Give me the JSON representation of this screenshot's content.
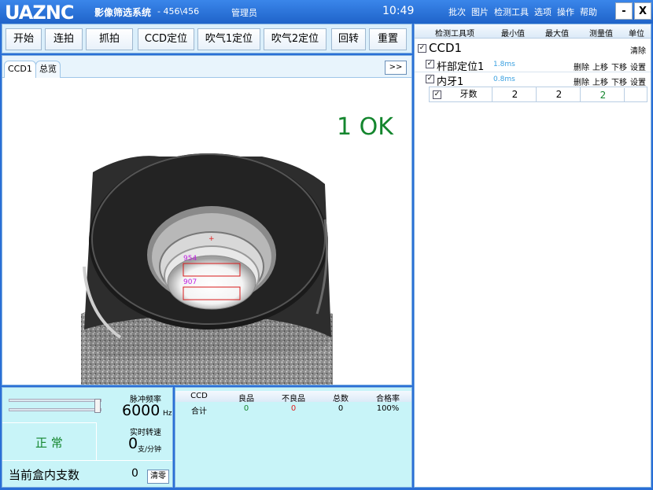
{
  "app": {
    "logo": "UAZNC",
    "name": "影像筛选系统",
    "version": "- 456\\456",
    "user": "管理员",
    "clock": "10:49",
    "menu": [
      "批次",
      "图片",
      "检测工具",
      "选项",
      "操作",
      "帮助"
    ],
    "minimize": "-",
    "close": "X"
  },
  "toolbar": {
    "buttons": [
      "开始",
      "连拍",
      "抓拍",
      "CCD定位",
      "吹气1定位",
      "吹气2定位",
      "回转",
      "重置"
    ]
  },
  "tabs": [
    "CCD1",
    "总览"
  ],
  "more_button": ">>",
  "viewer": {
    "result": "1 OK",
    "roi_labels": [
      "954",
      "907"
    ]
  },
  "tools": {
    "headers": [
      "检测工具项",
      "最小值",
      "最大值",
      "测量值",
      "单位"
    ],
    "ccd_name": "CCD1",
    "clear_label": "清除",
    "items": [
      {
        "name": "杆部定位1",
        "time": "1.8ms"
      },
      {
        "name": "内牙1",
        "time": "0.8ms"
      }
    ],
    "actions": [
      "删除",
      "上移",
      "下移",
      "设置"
    ],
    "sub": {
      "name": "牙数",
      "min": "2",
      "max": "2",
      "value": "2"
    }
  },
  "controls": {
    "pulse_label": "脉冲频率",
    "pulse_value": "6000",
    "pulse_unit": "Hz",
    "status": "正 常",
    "speed_label": "实时转速",
    "speed_value": "0",
    "speed_unit": "支/分钟",
    "box_label": "当前盒内支数",
    "box_value": "0",
    "reset_label": "清零",
    "slider_level": 0.98
  },
  "stats": {
    "headers": [
      "CCD",
      "良品",
      "不良品",
      "总数",
      "合格率"
    ],
    "row": [
      "合计",
      "0",
      "0",
      "0",
      "100%"
    ]
  },
  "colors": {
    "ok": "#14862e",
    "ng": "#e02020",
    "accent": "#2a6fd6",
    "time": "#3aa0e0"
  }
}
